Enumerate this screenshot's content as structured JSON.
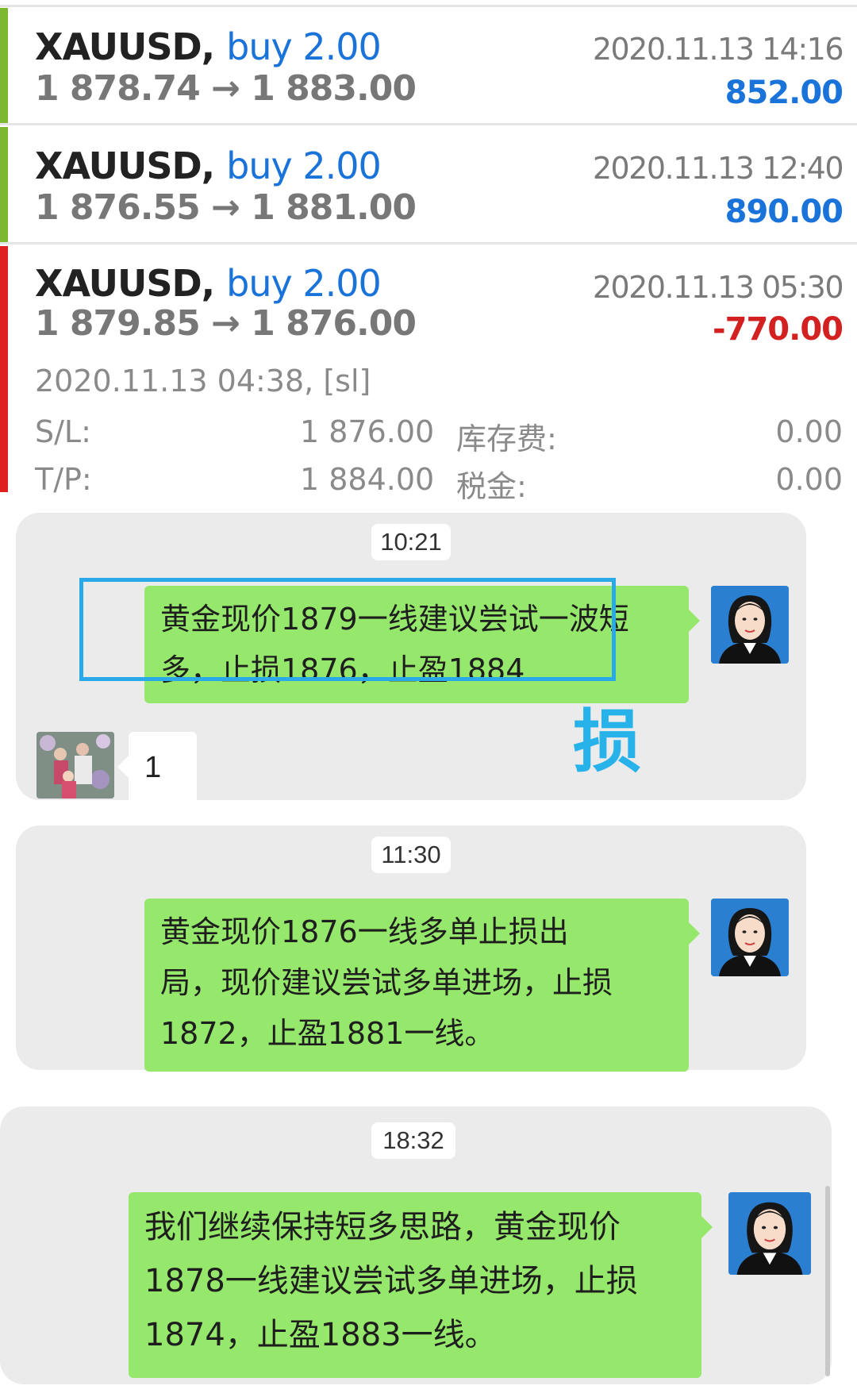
{
  "trades": [
    {
      "symbol": "XAUUSD,",
      "direction": "buy 2.00",
      "prices": "1 878.74 → 1 883.00",
      "datetime": "2020.11.13 14:16",
      "profit": "852.00",
      "bar_color": "#7cb82f",
      "profit_color": "#1a73d9"
    },
    {
      "symbol": "XAUUSD,",
      "direction": "buy 2.00",
      "prices": "1 876.55 → 1 881.00",
      "datetime": "2020.11.13 12:40",
      "profit": "890.00",
      "bar_color": "#7cb82f",
      "profit_color": "#1a73d9"
    },
    {
      "symbol": "XAUUSD,",
      "direction": "buy 2.00",
      "prices": "1 879.85 → 1 876.00",
      "datetime": "2020.11.13 05:30",
      "profit": "-770.00",
      "bar_color": "#e02020",
      "profit_color": "#d32020",
      "open_time": "2020.11.13 04:38, [sl]",
      "sl_label": "S/L:",
      "sl_value": "1 876.00",
      "tp_label": "T/P:",
      "tp_value": "1 884.00",
      "swap_label": "库存费:",
      "swap_value": "0.00",
      "tax_label": "税金:",
      "tax_value": "0.00"
    }
  ],
  "chats": [
    {
      "time": "10:21",
      "message_line1": "黄金现价1879一线建议尝试一波短",
      "message_line2": "多，止损1876，止盈1884",
      "reply": "1",
      "stamp": "损"
    },
    {
      "time": "11:30",
      "message_line1": "黄金现价1876一线多单止损出",
      "message_line2": "局，现价建议尝试多单进场，止损",
      "message_line3": "1872，止盈1881一线。"
    },
    {
      "time": "18:32",
      "message_line1": "我们继续保持短多思路，黄金现价",
      "message_line2": "1878一线建议尝试多单进场，止损",
      "message_line3": "1874，止盈1883一线。"
    }
  ],
  "colors": {
    "bubble_green": "#95e86b",
    "chat_bg": "#ebebeb",
    "highlight_blue": "#2aa9e8",
    "buy_blue": "#1a73d9"
  },
  "icons": {
    "sender_avatar": "woman-portrait-avatar",
    "receiver_avatar": "family-photo-avatar"
  }
}
